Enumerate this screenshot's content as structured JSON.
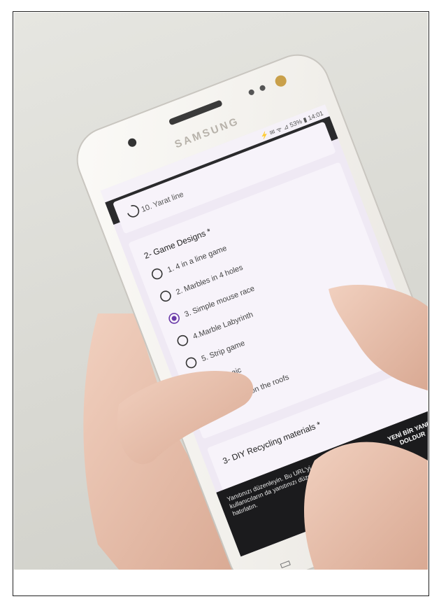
{
  "phone": {
    "brand": "SAMSUNG",
    "status_bar": "⚡ ✉ ᯤ ⊿ 53% ▮ 14:01",
    "nav_back_glyph": "⊃",
    "nav_recents_glyph": "▭"
  },
  "form": {
    "previous_section": "10. Yarat line",
    "question_2": {
      "title": "2- Game Designs *",
      "options": [
        "1. 4 in a line game",
        "2. Marbles in 4 holes",
        "3. Simple mouse race",
        "4.Marble Labyrinth",
        "5. Strip game",
        "6. Mosaic",
        "7. Marble on the roofs"
      ],
      "selected_index": 2
    },
    "question_3": {
      "title": "3- DIY Recycling materials *"
    }
  },
  "banner": {
    "message": "Yanıtınızı düzenleyin. Bu URL'yi paylaşırken diğer kullanıcıların da yanıtınızı düzenleyebileceğini hatırlatın.",
    "action": "YENİ BİR YANIT DOLDUR"
  },
  "colors": {
    "screen_bg": "#efe9f4",
    "card_bg": "#f7f3fa",
    "accent": "#6a3aa8",
    "banner_bg": "#1b1b1d",
    "phone_body": "#f4f2ee"
  }
}
